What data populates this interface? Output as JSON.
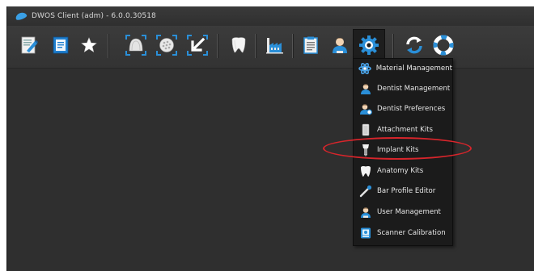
{
  "window": {
    "title": "DWOS Client (adm) - 6.0.0.30518"
  },
  "toolbar": {
    "buttons": [
      {
        "icon": "edit-document-icon"
      },
      {
        "icon": "open-document-icon"
      },
      {
        "icon": "star-icon"
      },
      {
        "icon": "scan-jaw-icon"
      },
      {
        "icon": "scan-plate-icon"
      },
      {
        "icon": "import-arrow-icon"
      },
      {
        "icon": "tooth-icon"
      },
      {
        "icon": "factory-icon"
      },
      {
        "icon": "clipboard-icon"
      },
      {
        "icon": "dentist-icon"
      },
      {
        "icon": "settings-gear-icon"
      },
      {
        "icon": "sync-icon"
      },
      {
        "icon": "help-lifebuoy-icon"
      }
    ]
  },
  "settings_menu": {
    "items": [
      {
        "label": "Material Management",
        "icon": "material-icon"
      },
      {
        "label": "Dentist Management",
        "icon": "dentist-icon"
      },
      {
        "label": "Dentist Preferences",
        "icon": "dentist-preferences-icon"
      },
      {
        "label": "Attachment Kits",
        "icon": "attachment-kit-icon"
      },
      {
        "label": "Implant Kits",
        "icon": "implant-icon"
      },
      {
        "label": "Anatomy Kits",
        "icon": "anatomy-tooth-icon"
      },
      {
        "label": "Bar Profile Editor",
        "icon": "bar-profile-icon"
      },
      {
        "label": "User Management",
        "icon": "user-icon"
      },
      {
        "label": "Scanner Calibration",
        "icon": "scanner-calibration-icon"
      }
    ]
  },
  "colors": {
    "accent_blue": "#2a8fd8",
    "annotation_red": "#d8252b",
    "menu_bg": "#1b1b1b"
  }
}
